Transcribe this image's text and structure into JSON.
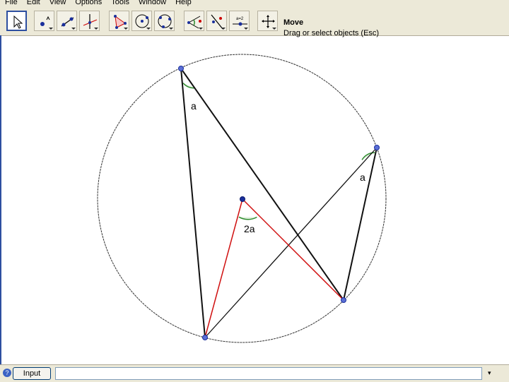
{
  "menu": [
    "File",
    "Edit",
    "View",
    "Options",
    "Tools",
    "Window",
    "Help"
  ],
  "toolbar": {
    "mode_title": "Move",
    "mode_description": "Drag or select objects (Esc)"
  },
  "canvas": {
    "angle_labels": [
      "a",
      "a",
      "2a"
    ]
  },
  "input_bar": {
    "button_label": "Input",
    "help_symbol": "?",
    "value": "",
    "dropdown_symbol": "▾"
  },
  "colors": {
    "ui_background": "#ece9d8",
    "point_blue": "#5b6fd6",
    "angle_green": "#2e8b2e",
    "red_segment": "#d01010",
    "black_segment": "#111111"
  }
}
